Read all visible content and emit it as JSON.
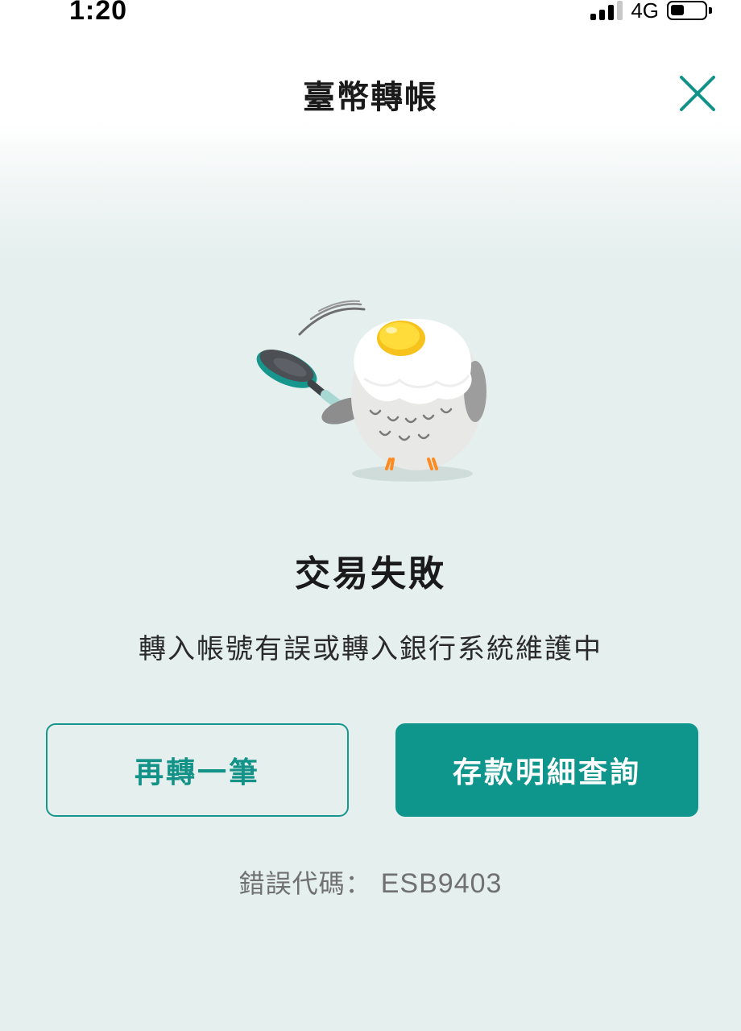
{
  "status_bar": {
    "time": "1:20",
    "network": "4G",
    "icons": [
      "signal-icon",
      "battery-icon"
    ]
  },
  "header": {
    "title": "臺幣轉帳",
    "close_icon": "close-icon",
    "accent_color": "#139288"
  },
  "result": {
    "illustration": "owl-with-frying-pan-illustration",
    "title": "交易失敗",
    "message": "轉入帳號有誤或轉入銀行系統維護中"
  },
  "actions": {
    "secondary_label": "再轉一筆",
    "primary_label": "存款明細查詢"
  },
  "error": {
    "label": "錯誤代碼：",
    "code": "ESB9403"
  }
}
